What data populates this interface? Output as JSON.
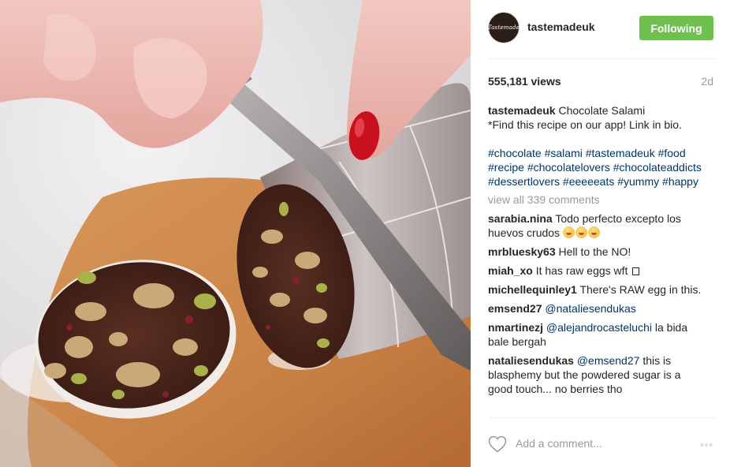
{
  "post": {
    "account": "tastemadeuk",
    "avatar_text": "Tastemade",
    "follow_label": "Following",
    "views": "555,181 views",
    "time_ago": "2d",
    "caption_user": "tastemadeuk",
    "caption_text": "Chocolate Salami",
    "caption_line2": "*Find this recipe on our app! Link in bio.",
    "hashtags": [
      "#chocolate",
      "#salami",
      "#tastemadeuk",
      "#food",
      "#recipe",
      "#chocolatelovers",
      "#chocolateaddicts",
      "#dessertlovers",
      "#eeeeeats",
      "#yummy",
      "#happy"
    ],
    "view_all": "view all 339 comments"
  },
  "comments": [
    {
      "user": "sarabia.nina",
      "text": "Todo perfecto excepto los huevos crudos",
      "emoji_count": 3
    },
    {
      "user": "mrbluesky63",
      "text": "Hell to the NO!"
    },
    {
      "user": "miah_xo",
      "text": "It has raw eggs wft"
    },
    {
      "user": "michellequinley1",
      "text": "There's RAW egg in this."
    },
    {
      "user": "emsend27",
      "mention": "@nataliesendukas",
      "text": ""
    },
    {
      "user": "nmartinezj",
      "mention": "@alejandrocasteluchi",
      "text": "la bida bale bergah"
    },
    {
      "user": "nataliesendukas",
      "mention": "@emsend27",
      "text": "this is blasphemy but the powdered sugar is a good touch... no berries tho"
    }
  ],
  "footer": {
    "add_comment_placeholder": "Add a comment...",
    "more": "◦◦◦"
  },
  "colors": {
    "follow_green": "#70c050",
    "link_blue": "#003569",
    "muted_grey": "#999999"
  },
  "icons": {
    "heart": "heart-outline-icon",
    "more": "more-options-icon"
  }
}
